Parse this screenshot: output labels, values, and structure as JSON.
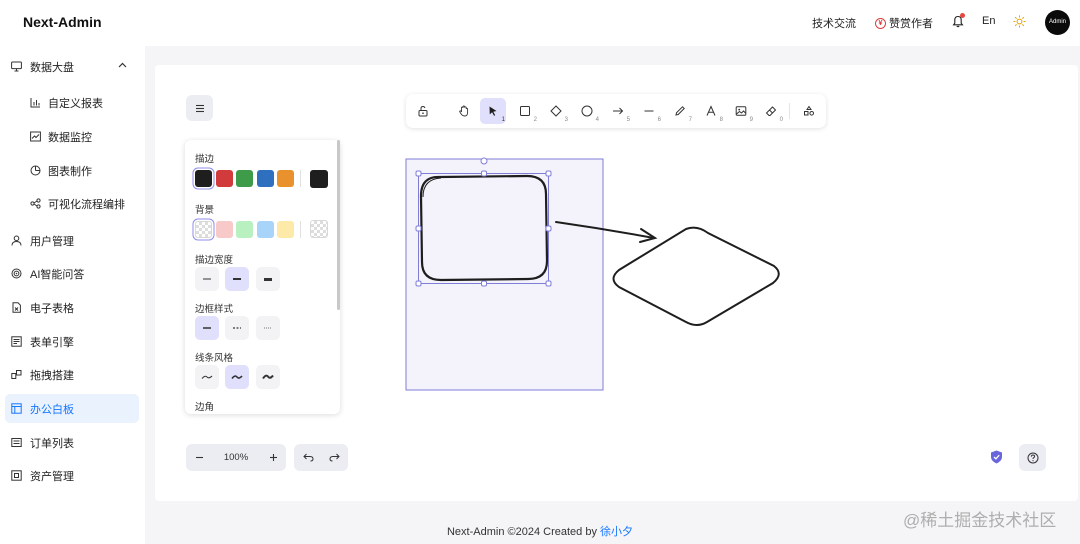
{
  "app": {
    "brand": "Next-Admin"
  },
  "header": {
    "tech_exchange": "技术交流",
    "sponsor": "赞赏作者",
    "lang": "En",
    "avatar_text": "Admin"
  },
  "sidebar": {
    "group": {
      "label": "数据大盘",
      "icon": "monitor-icon",
      "expanded": true
    },
    "sub_items": [
      {
        "label": "自定义报表",
        "icon": "bar-chart-icon"
      },
      {
        "label": "数据监控",
        "icon": "line-chart-icon"
      },
      {
        "label": "图表制作",
        "icon": "pie-chart-icon"
      },
      {
        "label": "可视化流程编排",
        "icon": "flow-icon"
      }
    ],
    "items": [
      {
        "label": "用户管理",
        "icon": "user-icon"
      },
      {
        "label": "AI智能问答",
        "icon": "ai-icon"
      },
      {
        "label": "电子表格",
        "icon": "spreadsheet-icon"
      },
      {
        "label": "表单引擎",
        "icon": "form-icon"
      },
      {
        "label": "拖拽搭建",
        "icon": "drag-build-icon"
      },
      {
        "label": "办公白板",
        "icon": "whiteboard-icon",
        "active": true
      },
      {
        "label": "订单列表",
        "icon": "order-icon"
      },
      {
        "label": "资产管理",
        "icon": "asset-icon"
      }
    ]
  },
  "toolbar": {
    "tools": [
      {
        "name": "lock",
        "num": ""
      },
      {
        "name": "hand",
        "num": ""
      },
      {
        "name": "selection",
        "num": "1",
        "active": true
      },
      {
        "name": "rectangle",
        "num": "2"
      },
      {
        "name": "diamond",
        "num": "3"
      },
      {
        "name": "ellipse",
        "num": "4"
      },
      {
        "name": "arrow",
        "num": "5"
      },
      {
        "name": "line",
        "num": "6"
      },
      {
        "name": "draw",
        "num": "7"
      },
      {
        "name": "text",
        "num": "8"
      },
      {
        "name": "image",
        "num": "9"
      },
      {
        "name": "eraser",
        "num": "0"
      },
      {
        "name": "library",
        "num": ""
      }
    ]
  },
  "panel": {
    "stroke_label": "描边",
    "background_label": "背景",
    "stroke_width_label": "描边宽度",
    "border_style_label": "边框样式",
    "line_style_label": "线条风格",
    "corner_label": "边角",
    "stroke_colors": [
      "#1e1e1e",
      "#d13b3b",
      "#3e9b49",
      "#2f6fbf",
      "#e8912d"
    ],
    "stroke_current": "#1e1e1e",
    "background_colors": [
      "transparent",
      "#f8c9c9",
      "#b8f0c0",
      "#a9d4fa",
      "#fde9a8"
    ],
    "background_current": "transparent"
  },
  "zoom": {
    "value": "100%"
  },
  "footer": {
    "text": "Next-Admin ©2024 Created by ",
    "author": "徐小夕"
  },
  "watermark": "@稀土掘金技术社区"
}
